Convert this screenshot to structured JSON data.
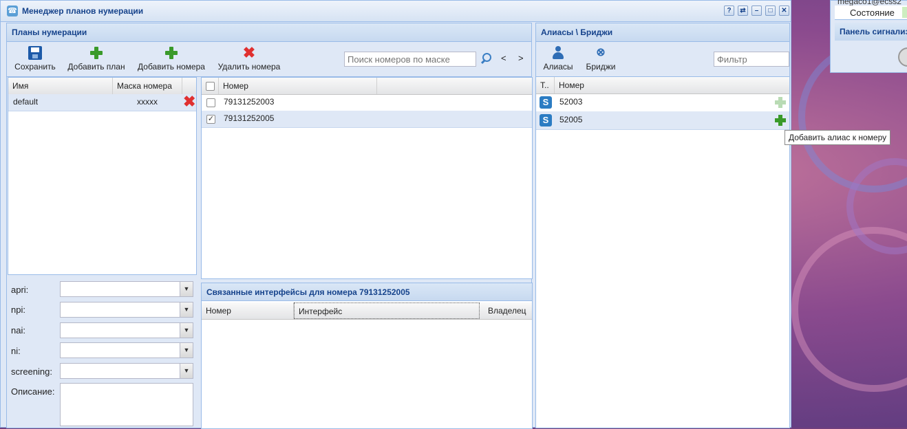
{
  "window": {
    "title": "Менеджер планов нумерации",
    "buttons": [
      "?",
      "⇄",
      "–",
      "□",
      "✕"
    ]
  },
  "background_panel": {
    "user": "megaco1@ecss2",
    "state_label": "Состояние",
    "signal_panel": "Панель сигнализ"
  },
  "plans": {
    "header": "Планы нумерации",
    "toolbar": {
      "save": "Сохранить",
      "add_plan": "Добавить план",
      "add_numbers": "Добавить номера",
      "delete_numbers": "Удалить номера"
    },
    "search_placeholder": "Поиск номеров по маске",
    "nav_prev": "<",
    "nav_next": ">",
    "plan_columns": {
      "name": "Имя",
      "mask": "Маска номера"
    },
    "plan_rows": [
      {
        "name": "default",
        "mask": "xxxxx"
      }
    ],
    "number_columns": {
      "number": "Номер"
    },
    "number_rows": [
      {
        "number": "79131252003",
        "checked": false
      },
      {
        "number": "79131252005",
        "checked": true
      }
    ],
    "form": {
      "apri": "apri:",
      "npi": "npi:",
      "nai": "nai:",
      "ni": "ni:",
      "screening": "screening:",
      "description": "Описание:"
    }
  },
  "linked": {
    "header": "Связанные интерфейсы для номера 79131252005",
    "columns": {
      "number": "Номер",
      "interface": "Интерфейс",
      "owner": "Владелец"
    }
  },
  "aliases": {
    "header": "Алиасы \\ Бриджи",
    "toolbar": {
      "aliases": "Алиасы",
      "bridges": "Бриджи"
    },
    "filter_placeholder": "Фильтр",
    "columns": {
      "type": "Т..",
      "number": "Номер"
    },
    "rows": [
      {
        "type_icon": "S",
        "number": "52003"
      },
      {
        "type_icon": "S",
        "number": "52005"
      }
    ],
    "tooltip": "Добавить алиас к номеру"
  }
}
